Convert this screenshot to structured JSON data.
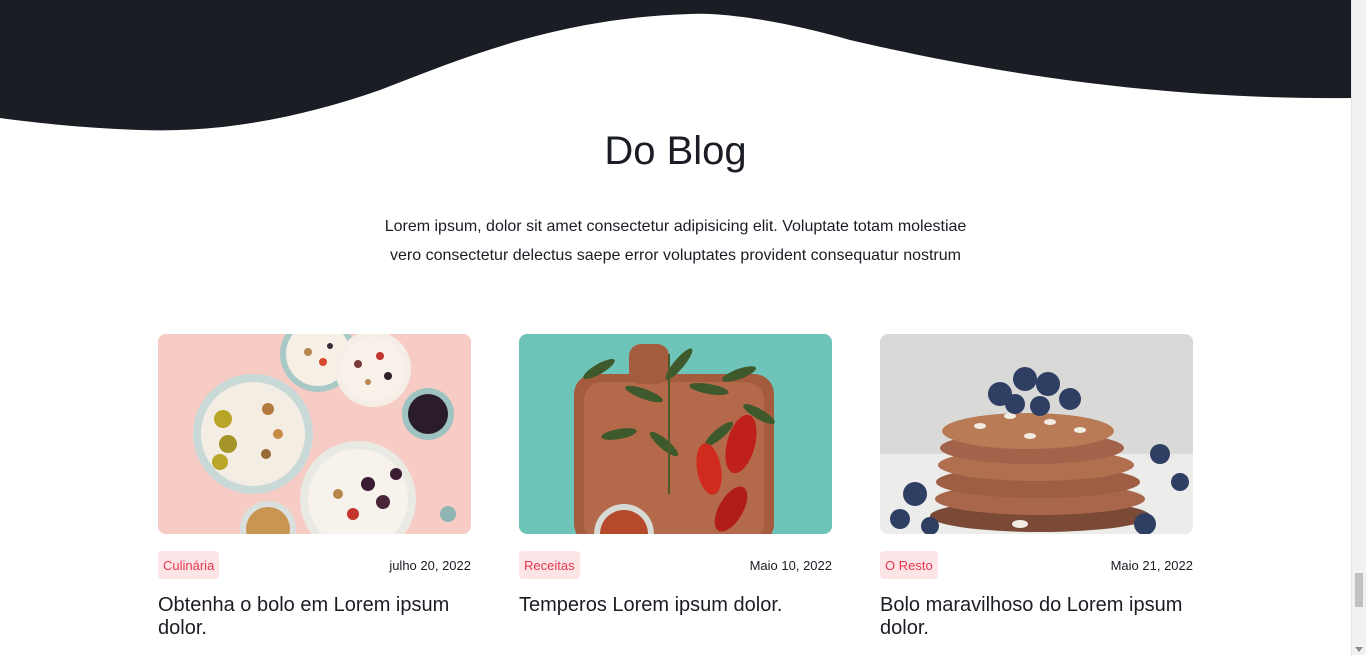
{
  "section": {
    "title": "Do Blog",
    "description": "Lorem ipsum, dolor sit amet consectetur adipisicing elit. Voluptate totam molestiae vero consectetur delectus saepe error voluptates provident consequatur nostrum"
  },
  "colors": {
    "dark_band": "#1b1d25",
    "badge_text": "#e8384f",
    "badge_bg": "#fde4e7"
  },
  "posts": [
    {
      "category": "Culinária",
      "date": "julho 20, 2022",
      "title": "Obtenha o bolo em Lorem ipsum dolor.",
      "image": "smoothie-bowls-image"
    },
    {
      "category": "Receitas",
      "date": "Maio 10, 2022",
      "title": "Temperos Lorem ipsum dolor.",
      "image": "peppers-cutting-board-image"
    },
    {
      "category": "O Resto",
      "date": "Maio 21, 2022",
      "title": "Bolo maravilhoso do Lorem ipsum dolor.",
      "image": "pancakes-blueberries-image"
    }
  ]
}
